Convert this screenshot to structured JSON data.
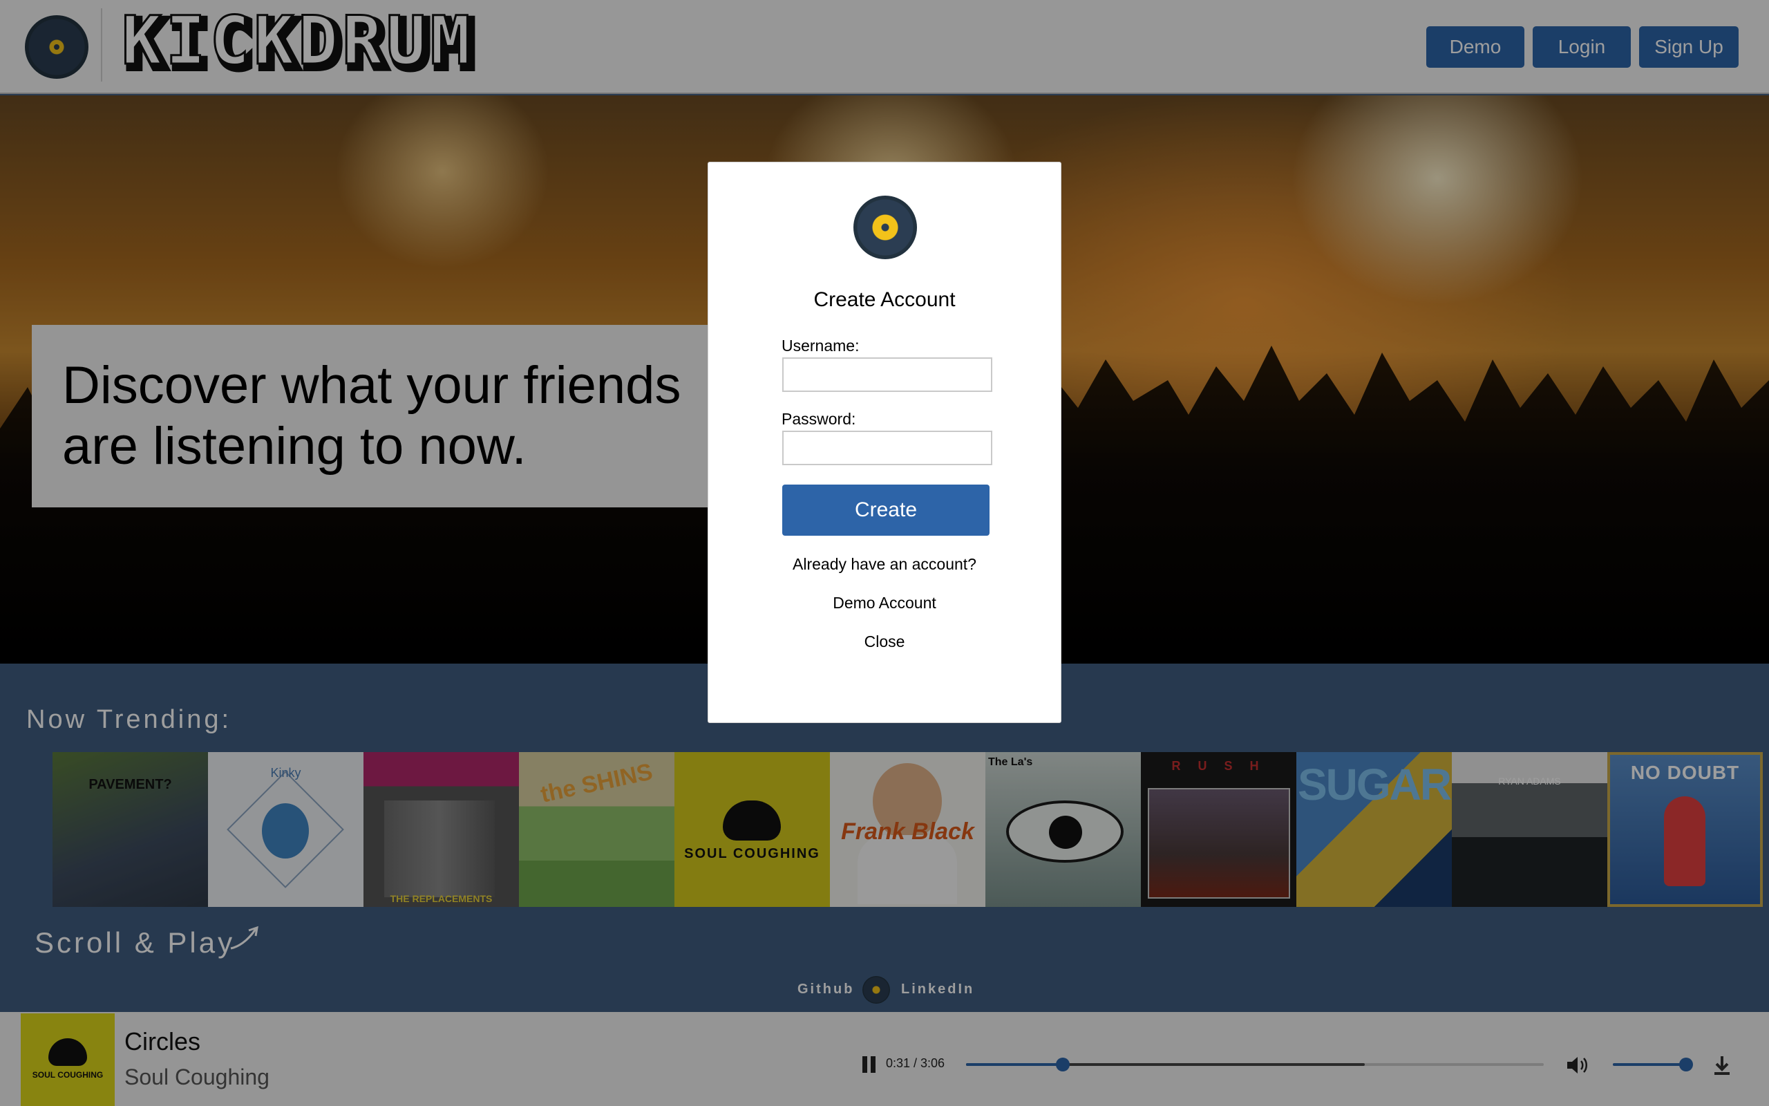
{
  "header": {
    "brand": "KICKDRUM",
    "nav": {
      "demo": "Demo",
      "login": "Login",
      "signup": "Sign Up"
    }
  },
  "hero": {
    "tagline": "Discover what your friends are listening to now."
  },
  "trending": {
    "title": "Now Trending:",
    "albums": [
      {
        "icon": "album-cover-pavement",
        "text": "PAVEMENT?"
      },
      {
        "icon": "album-cover-kinks",
        "text": "Kinky"
      },
      {
        "icon": "album-cover-replacements",
        "text": "THE REPLACEMENTS"
      },
      {
        "icon": "album-cover-shins",
        "text": "the SHINS"
      },
      {
        "icon": "album-cover-soul-coughing",
        "text": "SOUL COUGHING"
      },
      {
        "icon": "album-cover-frank-black",
        "text": "Frank Black"
      },
      {
        "icon": "album-cover-las",
        "text": "The La's"
      },
      {
        "icon": "album-cover-rush",
        "text": "R U S H"
      },
      {
        "icon": "album-cover-sugar",
        "text": "SUGAR"
      },
      {
        "icon": "album-cover-ryan-adams",
        "text": "RYAN ADAMS"
      },
      {
        "icon": "album-cover-no-doubt",
        "text": "NO DOUBT"
      }
    ],
    "scroll_hint": "Scroll & Play"
  },
  "footer": {
    "github": "Github",
    "linkedin": "LinkedIn"
  },
  "player": {
    "title": "Circles",
    "artist": "Soul Coughing",
    "art_text": "SOUL COUGHING",
    "time": "0:31 / 3:06",
    "progress_fraction": 0.167,
    "buffered_fraction": 0.69,
    "volume_fraction": 1.0
  },
  "modal": {
    "title": "Create Account",
    "username_label": "Username:",
    "password_label": "Password:",
    "username_value": "",
    "password_value": "",
    "create_label": "Create",
    "already_account": "Already have an account?",
    "demo_account": "Demo Account",
    "close": "Close"
  },
  "colors": {
    "accent": "#2d64a8",
    "band": "#3f5d80",
    "vinyl_yellow": "#f3c21a",
    "vinyl_dark": "#2b3d52"
  }
}
